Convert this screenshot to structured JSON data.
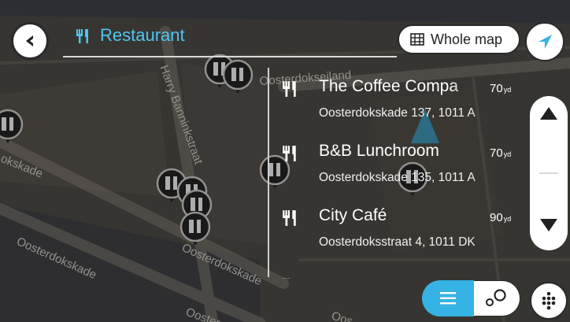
{
  "search": {
    "query": "Restaurant"
  },
  "whole_map_label": "Whole map",
  "results": [
    {
      "name": "The Coffee Compa",
      "address": "Oosterdokskade 137, 1011 A",
      "distance": "70",
      "unit": "yd"
    },
    {
      "name": "B&B Lunchroom",
      "address": "Oosterdokskade 135, 1011 A",
      "distance": "70",
      "unit": "yd"
    },
    {
      "name": "City Café",
      "address": "Oosterdoksstraat 4, 1011 DK",
      "distance": "90",
      "unit": "yd"
    }
  ],
  "map_labels": {
    "street1": "Harry Banninkstraat",
    "street2": "Oosterdokskade",
    "street3": "Oosterdokskade",
    "street4": "okskade",
    "street5": "Oosterdokseiland",
    "street6": "straat",
    "street7": "Ooster",
    "street8": "Oos"
  },
  "colors": {
    "accent": "#35b3e4",
    "search_text": "#4ec5f1",
    "map_bg": "#4a4740"
  },
  "icons": {
    "back": "chevron-left-icon",
    "category": "fork-knife-icon",
    "whole_map": "map-icon",
    "navigate": "navigation-arrow-icon",
    "scroll_up": "triangle-up-icon",
    "scroll_down": "triangle-down-icon",
    "list_view": "list-icon",
    "map_view": "pins-icon",
    "menu": "dots-grid-icon"
  }
}
